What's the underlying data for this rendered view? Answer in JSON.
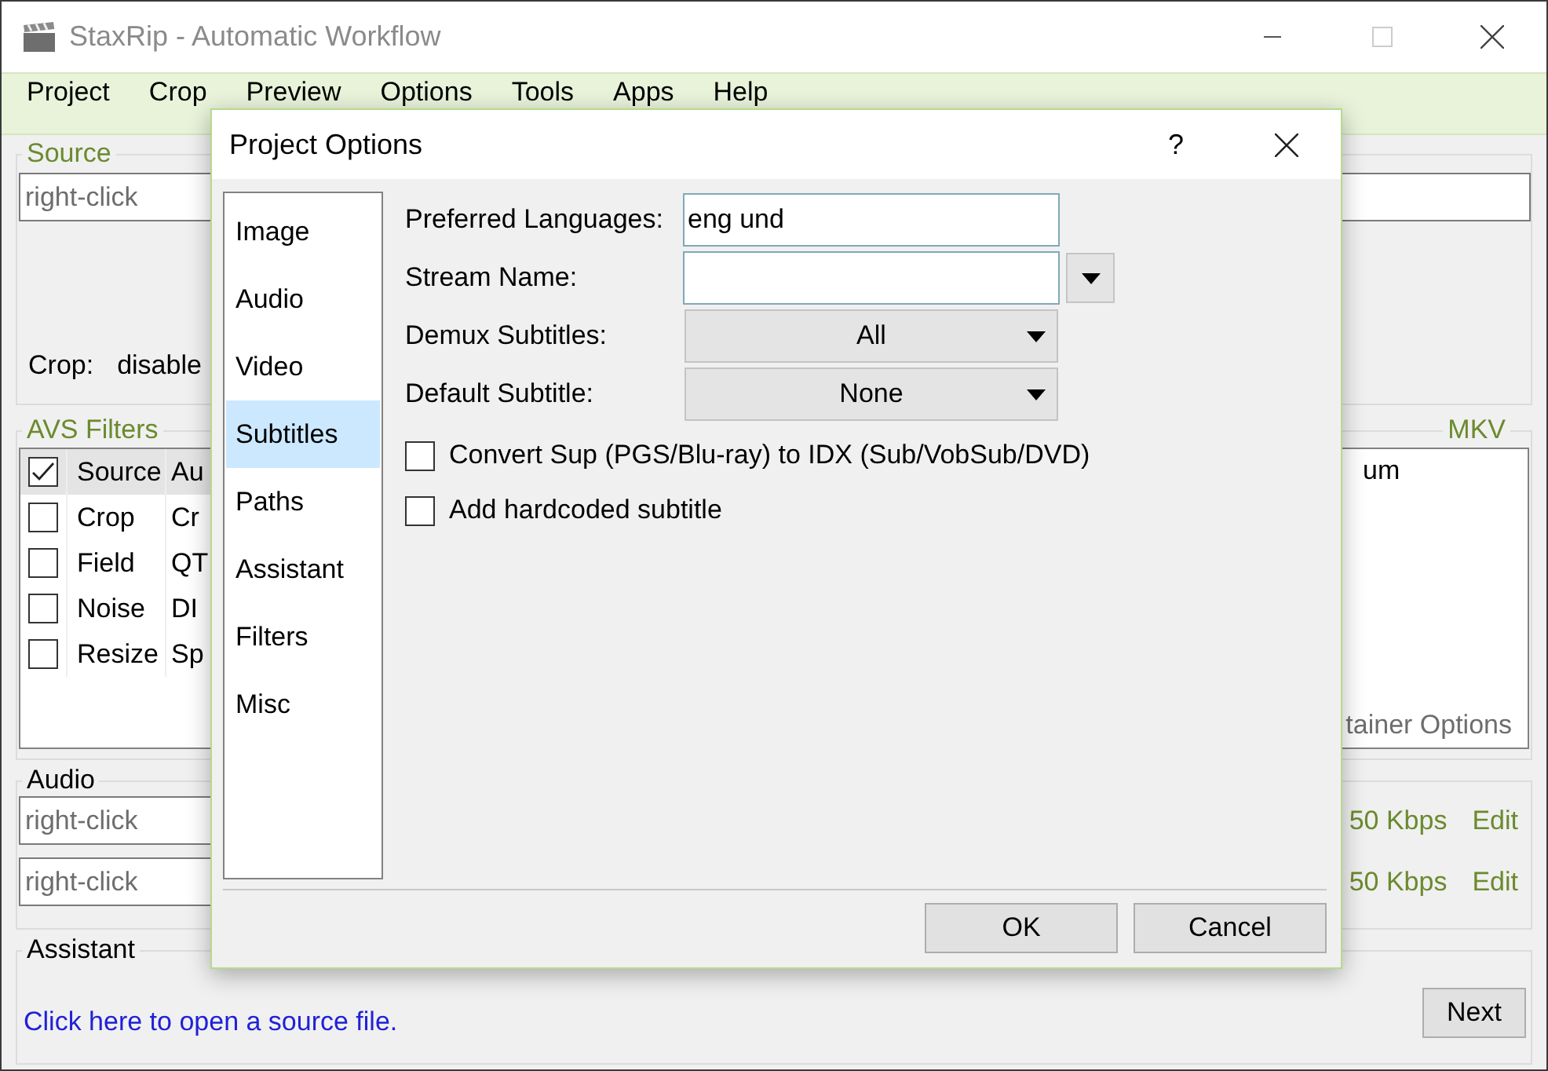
{
  "window": {
    "title": "StaxRip - Automatic Workflow"
  },
  "menu": [
    "Project",
    "Crop",
    "Preview",
    "Options",
    "Tools",
    "Apps",
    "Help"
  ],
  "source": {
    "label": "Source",
    "field": {
      "value": "right-click"
    },
    "crop_label": "Crop:",
    "crop_value": "disable"
  },
  "avs_filters": {
    "label": "AVS Filters",
    "rows": [
      {
        "name": "Source",
        "column_2": "Au",
        "checked": true,
        "selected": true
      },
      {
        "name": "Crop",
        "column_2": "Cr",
        "checked": false,
        "selected": false
      },
      {
        "name": "Field",
        "column_2": "QT",
        "checked": false,
        "selected": false
      },
      {
        "name": "Noise",
        "column_2": "DI",
        "checked": false,
        "selected": false
      },
      {
        "name": "Resize",
        "column_2": "Sp",
        "checked": false,
        "selected": false
      }
    ]
  },
  "container": {
    "label": "MKV",
    "item": "um",
    "link": "tainer Options"
  },
  "audio": {
    "label": "Audio",
    "tracks": [
      {
        "value": "right-click",
        "bitrate": "50 Kbps",
        "edit": "Edit"
      },
      {
        "value": "right-click",
        "bitrate": "50 Kbps",
        "edit": "Edit"
      }
    ]
  },
  "assistant": {
    "label": "Assistant",
    "link": "Click here to open a source file.",
    "next": "Next"
  },
  "dialog": {
    "title": "Project Options",
    "help": "?",
    "pages": [
      {
        "label": "Image",
        "selected": false
      },
      {
        "label": "Audio",
        "selected": false
      },
      {
        "label": "Video",
        "selected": false
      },
      {
        "label": "Subtitles",
        "selected": true
      },
      {
        "label": "Paths",
        "selected": false
      },
      {
        "label": "Assistant",
        "selected": false
      },
      {
        "label": "Filters",
        "selected": false
      },
      {
        "label": "Misc",
        "selected": false
      }
    ],
    "settings": [
      {
        "kind": "text",
        "label": "Preferred Languages:",
        "value": "eng und"
      },
      {
        "kind": "text_menu",
        "label": "Stream Name:"
      },
      {
        "kind": "combo",
        "label": "Demux Subtitles:",
        "value": "All"
      },
      {
        "kind": "combo",
        "label": "Default Subtitle:",
        "value": "None"
      }
    ],
    "options": [
      {
        "label": "Convert Sup (PGS/Blu-ray) to IDX (Sub/VobSub/DVD)",
        "checked": false
      },
      {
        "label": "Add hardcoded subtitle",
        "checked": false
      }
    ],
    "buttons": [
      "OK",
      "Cancel"
    ]
  }
}
